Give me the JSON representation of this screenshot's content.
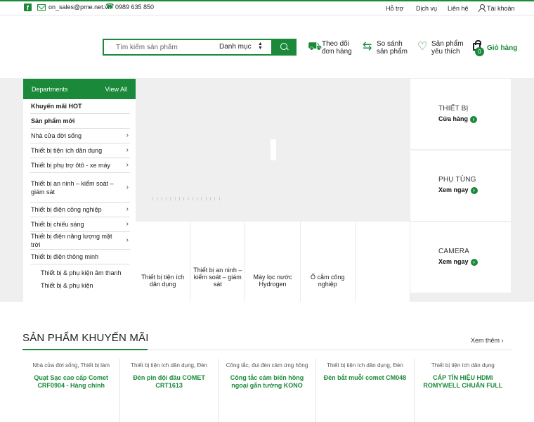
{
  "topbar": {
    "email": "on_sales@pme.net.vn",
    "phone": "0989 635 850",
    "links": [
      "Hỗ trợ",
      "Dịch vụ",
      "Liên hệ"
    ],
    "account": "Tài khoản"
  },
  "search": {
    "placeholder": "Tìm kiếm sản phẩm",
    "category": "Danh mục"
  },
  "header_actions": {
    "track": [
      "Theo dõi",
      "đơn hàng"
    ],
    "compare": [
      "So sánh",
      "sản phẩm"
    ],
    "wishlist": [
      "Sản phẩm",
      "yêu thích"
    ],
    "cart_label": "Giỏ hàng",
    "cart_count": "0"
  },
  "departments": {
    "title": "Departments",
    "view_all": "View All",
    "items": [
      {
        "label": "Khuyến mãi HOT"
      },
      {
        "label": "Sản phẩm mới"
      },
      {
        "label": "Nhà cửa đời sống"
      },
      {
        "label": "Thiết bị tiện ích dân dụng"
      },
      {
        "label": "Thiết bị phụ trợ ôtô - xe máy"
      },
      {
        "label": "Thiết bị an ninh – kiểm soát – giám sát"
      },
      {
        "label": "Thiết bị điện công nghiệp"
      },
      {
        "label": "Thiết bị chiếu sáng"
      },
      {
        "label": "Thiết bị điện năng lượng mặt trời"
      },
      {
        "label": "Thiết bị điện thông minh"
      }
    ],
    "sub_items": [
      "Thiết bị & phụ kiện âm thanh",
      "Thiết bị & phụ kiện"
    ]
  },
  "tiles": [
    "Thiết bị tiện ích dân dụng",
    "Thiết bị an ninh – kiểm soát – giám sát",
    "Máy lọc nước Hydrogen",
    "Ổ cắm công nghiệp",
    ""
  ],
  "side_banners": [
    {
      "title": "THIẾT BỊ",
      "link": "Cửa hàng"
    },
    {
      "title": "PHỤ TÙNG",
      "link": "Xem ngay"
    },
    {
      "title": "CAMERA",
      "link": "Xem ngay"
    }
  ],
  "promo": {
    "title": "SẢN PHẨM KHUYẾN MÃI",
    "more": "Xem thêm",
    "products": [
      {
        "cat": "Nhà cửa đời sống, Thiết bị làm",
        "name": "Quạt Sạc cao cấp Comet CRF0904 - Hàng chính"
      },
      {
        "cat": "Thiết bị tiện ích dân dụng, Đèn",
        "name": "Đèn pin đội đầu COMET CRT1613"
      },
      {
        "cat": "Công tắc, đui đèn cảm ứng hồng",
        "name": "Công tắc cảm biến hồng ngoại gắn tường KONO"
      },
      {
        "cat": "Thiết bị tiện ích dân dụng, Đèn",
        "name": "Đèn bắt muỗi comet CM048"
      },
      {
        "cat": "Thiết bị tiện ích dân dụng",
        "name": "CÁP TÍN HIỆU HDMI ROMYWELL CHUẨN FULL"
      }
    ]
  }
}
